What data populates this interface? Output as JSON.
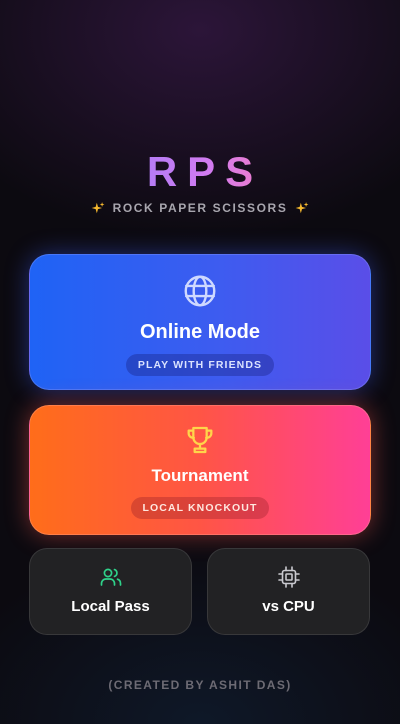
{
  "app": {
    "title": "RPS",
    "subtitle": "ROCK PAPER SCISSORS"
  },
  "modes": {
    "online": {
      "title": "Online Mode",
      "tag": "PLAY WITH FRIENDS",
      "icon": "globe-icon"
    },
    "tournament": {
      "title": "Tournament",
      "tag": "LOCAL KNOCKOUT",
      "icon": "trophy-icon"
    },
    "local": {
      "title": "Local Pass",
      "icon": "users-icon"
    },
    "cpu": {
      "title": "vs CPU",
      "icon": "cpu-chip-icon"
    }
  },
  "footer": {
    "credit": "(CREATED BY ASHIT DAS)"
  },
  "colors": {
    "online_gradient": [
      "#1f63f5",
      "#5a4ee8"
    ],
    "tournament_gradient": [
      "#ff6d1a",
      "#ff3f96"
    ],
    "title_gradient": [
      "#b57cf5",
      "#ec7ccc"
    ],
    "sparkle": "#f5b82e",
    "local_icon": "#2fd28a",
    "cpu_icon": "#c9c9cf",
    "trophy_icon": "#ffd54a"
  }
}
